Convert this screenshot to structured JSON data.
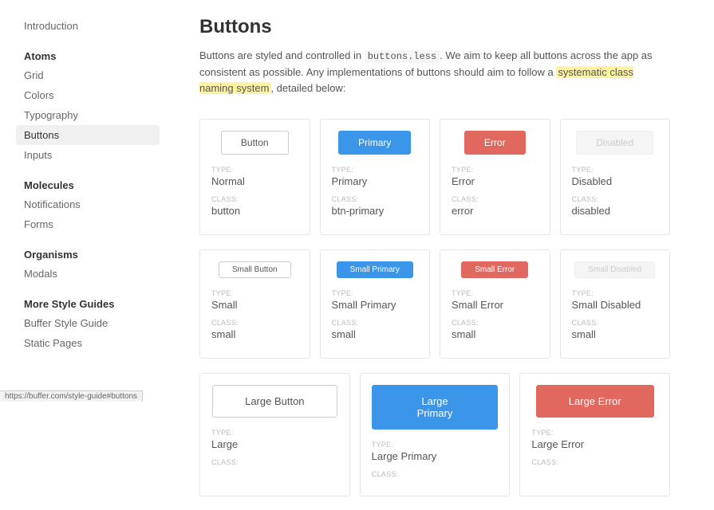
{
  "sidebar": {
    "intro": "Introduction",
    "groups": [
      {
        "heading": "Atoms",
        "items": [
          {
            "label": "Grid",
            "active": false
          },
          {
            "label": "Colors",
            "active": false
          },
          {
            "label": "Typography",
            "active": false
          },
          {
            "label": "Buttons",
            "active": true
          },
          {
            "label": "Inputs",
            "active": false
          }
        ]
      },
      {
        "heading": "Molecules",
        "items": [
          {
            "label": "Notifications",
            "active": false
          },
          {
            "label": "Forms",
            "active": false
          }
        ]
      },
      {
        "heading": "Organisms",
        "items": [
          {
            "label": "Modals",
            "active": false
          }
        ]
      },
      {
        "heading": "More Style Guides",
        "items": [
          {
            "label": "Buffer Style Guide",
            "active": false
          },
          {
            "label": "Static Pages",
            "active": false
          }
        ]
      }
    ]
  },
  "page": {
    "title": "Buttons",
    "intro_before": "Buttons are styled and controlled in ",
    "intro_code": "buttons.less",
    "intro_mid": ". We aim to keep all buttons across the app as consistent as possible. Any implementations of buttons should aim to follow a ",
    "intro_highlight": "systematic class naming system",
    "intro_after": ", detailed below:"
  },
  "labels": {
    "type": "TYPE:",
    "class": "CLASS:"
  },
  "row1": [
    {
      "label": "Button",
      "style": "",
      "type": "Normal",
      "class": "button"
    },
    {
      "label": "Primary",
      "style": "btn-primary",
      "type": "Primary",
      "class": "btn-primary"
    },
    {
      "label": "Error",
      "style": "btn-error",
      "type": "Error",
      "class": "error"
    },
    {
      "label": "Disabled",
      "style": "btn-disabled",
      "type": "Disabled",
      "class": "disabled"
    }
  ],
  "row2": [
    {
      "label": "Small Button",
      "style": "",
      "type": "Small",
      "class": "small"
    },
    {
      "label": "Small Primary",
      "style": "btn-primary",
      "type": "Small Primary",
      "class": "small"
    },
    {
      "label": "Small Error",
      "style": "btn-error",
      "type": "Small Error",
      "class": "small"
    },
    {
      "label": "Small Disabled",
      "style": "btn-disabled",
      "type": "Small Disabled",
      "class": "small"
    }
  ],
  "row3": [
    {
      "label": "Large Button",
      "style": "",
      "type": "Large",
      "class": ""
    },
    {
      "label": "Large Primary",
      "style": "btn-primary",
      "type": "Large Primary",
      "class": ""
    },
    {
      "label": "Large Error",
      "style": "btn-error",
      "type": "Large Error",
      "class": ""
    }
  ],
  "statusbar": "https://buffer.com/style-guide#buttons"
}
